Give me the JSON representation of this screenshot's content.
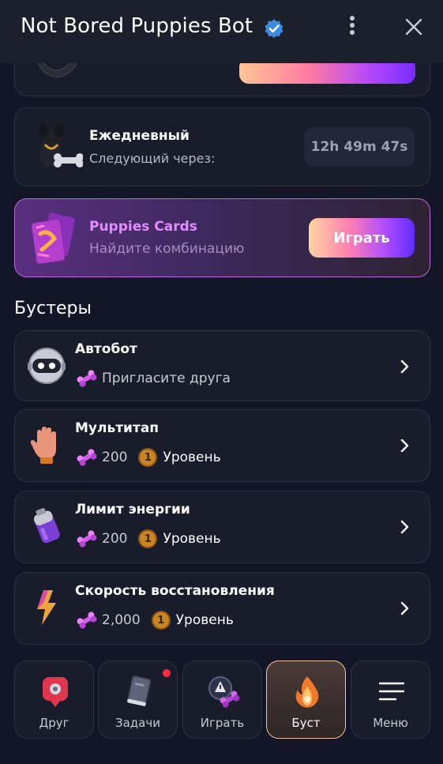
{
  "header": {
    "title": "Not Bored Puppies Bot",
    "verified_icon": "verified-badge-icon",
    "more_icon": "kebab-menu-icon",
    "close_icon": "close-icon"
  },
  "daily": {
    "title": "Ежедневный",
    "subtitle": "Следующий через:",
    "timer": "12h 49m 47s",
    "icon": "puppy-daily-icon"
  },
  "puppies_cards": {
    "title": "Puppies Cards",
    "subtitle": "Найдите комбинацию",
    "button": "Играть",
    "icon": "cards-icon"
  },
  "boosters": {
    "section_title": "Бустеры",
    "items": [
      {
        "title": "Автобот",
        "cost": "Пригласите друга",
        "level": "",
        "icon": "robot-icon"
      },
      {
        "title": "Мультитап",
        "cost": "200",
        "level_number": "1",
        "level": "Уровень",
        "icon": "hand-icon"
      },
      {
        "title": "Лимит энергии",
        "cost": "200",
        "level_number": "1",
        "level": "Уровень",
        "icon": "battery-icon"
      },
      {
        "title": "Скорость восстановления",
        "cost": "2,000",
        "level_number": "1",
        "level": "Уровень",
        "icon": "lightning-icon"
      }
    ]
  },
  "nav": {
    "items": [
      {
        "label": "Друг",
        "icon": "friend-icon"
      },
      {
        "label": "Задачи",
        "icon": "book-icon"
      },
      {
        "label": "Играть",
        "icon": "game-icon"
      },
      {
        "label": "Буст",
        "icon": "fire-icon"
      },
      {
        "label": "Меню",
        "icon": "menu-icon"
      }
    ],
    "active": "Буст"
  },
  "colors": {
    "background": "#121626",
    "card": "#181c2b",
    "accent_pink": "#e48cff",
    "active_border": "#f2c39c",
    "notification": "#ff2b44"
  }
}
